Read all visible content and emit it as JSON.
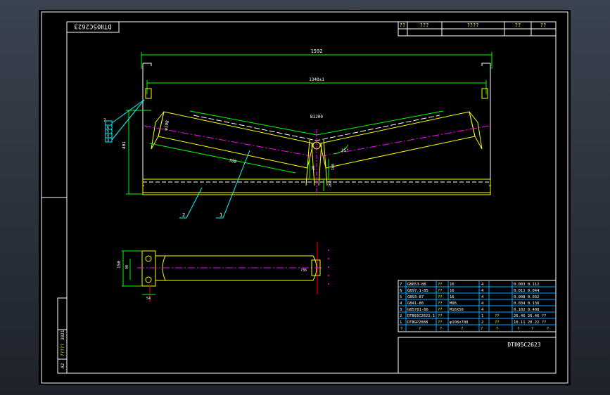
{
  "title_block_rotated": "DTⅡ05C2623",
  "revision_header": [
    "??",
    "???",
    "????",
    "??",
    "??"
  ],
  "dims": {
    "overall_width": "1592",
    "inner_width": "1340±1",
    "belt_width": "B1200",
    "height": "401",
    "roll_length": "700",
    "roll_dia": "φ108",
    "angle": "35°",
    "center_gap": "20",
    "offset_a": "100",
    "offset_b": "260",
    "roll_height": "150",
    "roll_height_b": "90",
    "base_w": "54",
    "tube_label": "?36"
  },
  "callouts": [
    "1",
    "2",
    "3",
    "4",
    "5",
    "6",
    "7"
  ],
  "parts_list": [
    {
      "no": "7",
      "code": "GB653-88",
      "name": "??",
      "spec": "16",
      "qty": "4",
      "weight": "0.003 0.112"
    },
    {
      "no": "6",
      "code": "GB97.1-85",
      "name": "??",
      "spec": "16",
      "qty": "4",
      "weight": "0.011 0.044"
    },
    {
      "no": "5",
      "code": "GB93-87",
      "name": "??",
      "spec": "16",
      "qty": "4",
      "weight": "0.008 0.032"
    },
    {
      "no": "4",
      "code": "GB41-86",
      "name": "??",
      "spec": "M06",
      "qty": "4",
      "weight": "0.034 0.136"
    },
    {
      "no": "3",
      "code": "GB5781-86",
      "name": "??",
      "spec": "M16X50",
      "qty": "4",
      "weight": "0.102 0.408"
    },
    {
      "no": "2",
      "code": "DTⅡ03C2622.1",
      "name": "??",
      "spec": "",
      "qty": "1",
      "mat": "??",
      "weight": "26.46 26.46 ??"
    },
    {
      "no": "1",
      "code": "DTⅡGP2088",
      "name": "??",
      "spec": "φ108x700",
      "qty": "2",
      "mat": "??",
      "weight": "10.11 20.22 ??"
    }
  ],
  "parts_header": [
    "?",
    "?",
    "?",
    "?",
    "?",
    "?",
    "?",
    "?",
    "?"
  ],
  "drawing_number": "DTⅡ05C2623",
  "side_strip": {
    "a": "A2",
    "b": "?????",
    "c": "3821"
  }
}
